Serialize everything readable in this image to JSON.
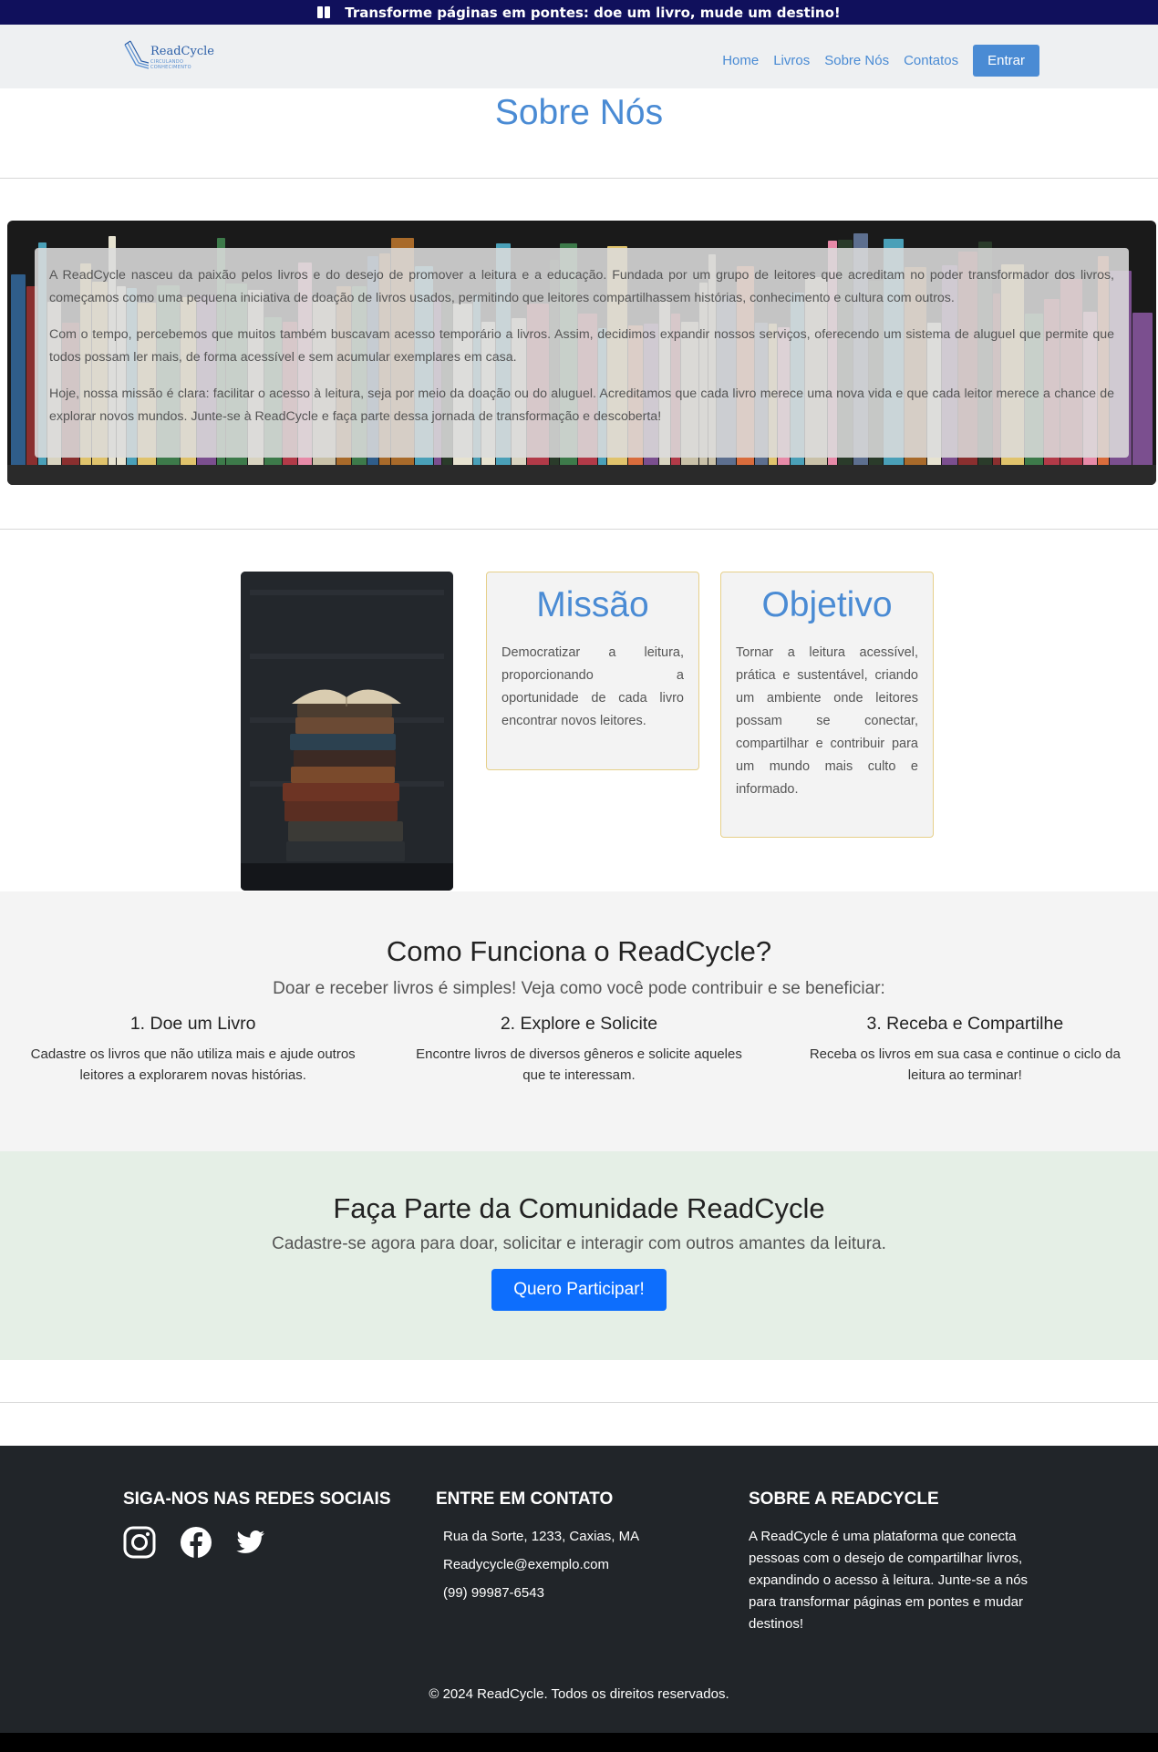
{
  "banner": {
    "text": "Transforme páginas em pontes: doe um livro, mude um destino!",
    "icon": "book-icon"
  },
  "nav": {
    "logo_name": "ReadCycle",
    "logo_tagline": "CIRCULANDO CONHECIMENTO",
    "links": [
      "Home",
      "Livros",
      "Sobre Nós",
      "Contatos"
    ],
    "login_label": "Entrar"
  },
  "page": {
    "title": "Sobre Nós"
  },
  "hero": {
    "paragraphs": [
      "A ReadCycle nasceu da paixão pelos livros e do desejo de promover a leitura e a educação. Fundada por um grupo de leitores que acreditam no poder transformador dos livros, começamos como uma pequena iniciativa de doação de livros usados, permitindo que leitores compartilhassem histórias, conhecimento e cultura com outros.",
      "Com o tempo, percebemos que muitos também buscavam acesso temporário a livros. Assim, decidimos expandir nossos serviços, oferecendo um sistema de aluguel que permite que todos possam ler mais, de forma acessível e sem acumular exemplares em casa.",
      "Hoje, nossa missão é clara: facilitar o acesso à leitura, seja por meio da doação ou do aluguel. Acreditamos que cada livro merece uma nova vida e que cada leitor merece a chance de explorar novos mundos. Junte-se à ReadCycle e faça parte dessa jornada de transformação e descoberta!"
    ]
  },
  "mission": {
    "card1": {
      "title": "Missão",
      "text": "Democratizar a leitura, proporcionando a oportunidade de cada livro encontrar novos leitores."
    },
    "card2": {
      "title": "Objetivo",
      "text": "Tornar a leitura acessível, prática e sustentável, criando um ambiente onde leitores possam se conectar, compartilhar e contribuir para um mundo mais culto e informado."
    }
  },
  "how": {
    "title": "Como Funciona o ReadCycle?",
    "lead": "Doar e receber livros é simples! Veja como você pode contribuir e se beneficiar:",
    "steps": [
      {
        "title": "1. Doe um Livro",
        "text": "Cadastre os livros que não utiliza mais e ajude outros leitores a explorarem novas histórias."
      },
      {
        "title": "2. Explore e Solicite",
        "text": "Encontre livros de diversos gêneros e solicite aqueles que te interessam."
      },
      {
        "title": "3. Receba e Compartilhe",
        "text": "Receba os livros em sua casa e continue o ciclo da leitura ao terminar!"
      }
    ]
  },
  "community": {
    "title": "Faça Parte da Comunidade ReadCycle",
    "lead": "Cadastre-se agora para doar, solicitar e interagir com outros amantes da leitura.",
    "cta": "Quero Participar!"
  },
  "footer": {
    "social_title": "SIGA-NOS NAS REDES SOCIAIS",
    "social_icons": [
      "instagram-icon",
      "facebook-icon",
      "twitter-icon"
    ],
    "contact_title": "ENTRE EM CONTATO",
    "address": "Rua da Sorte, 1233, Caxias, MA",
    "email": "Readycycle@exemplo.com",
    "phone": "(99) 99987-6543",
    "about_title": "SOBRE A READCYCLE",
    "about_text": "A ReadCycle é uma plataforma que conecta pessoas com o desejo de compartilhar livros, expandindo o acesso à leitura. Junte-se a nós para transformar páginas em pontes e mudar destinos!",
    "copyright": "© 2024 ReadCycle. Todos os direitos reservados."
  },
  "colors": {
    "accent": "#4a8bd4",
    "banner": "#10105c",
    "footer": "#212529",
    "cta": "#0d6efd",
    "community_bg": "#e5efe6"
  }
}
